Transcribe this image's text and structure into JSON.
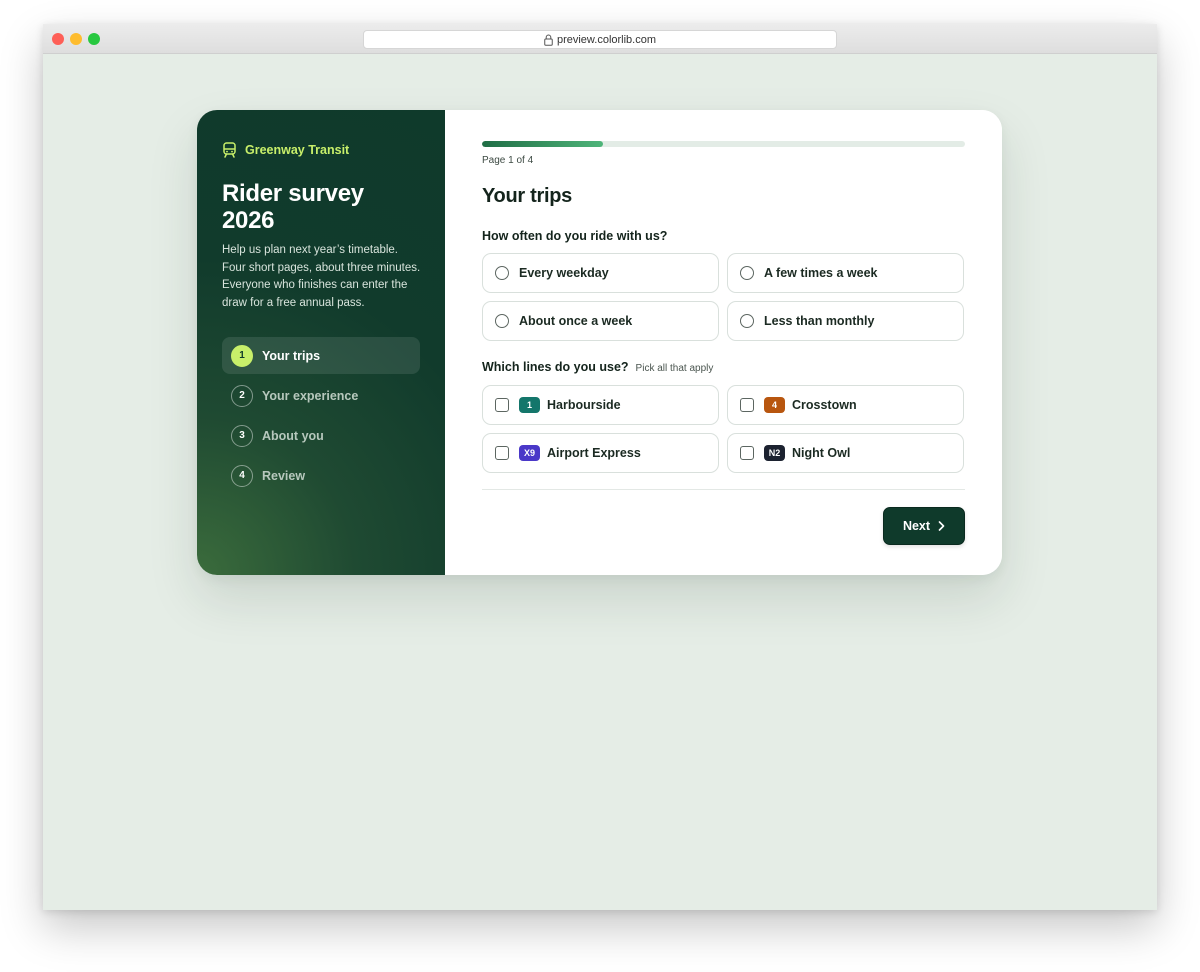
{
  "browser": {
    "url": "preview.colorlib.com"
  },
  "brand": {
    "name": "Greenway Transit",
    "icon": "bus-icon"
  },
  "sidebar": {
    "title": "Rider survey 2026",
    "description": "Help us plan next year’s timetable. Four short pages, about three minutes. Everyone who finishes can enter the draw for a free annual pass.",
    "steps": [
      {
        "num": "1",
        "label": "Your trips",
        "active": true
      },
      {
        "num": "2",
        "label": "Your experience",
        "active": false
      },
      {
        "num": "3",
        "label": "About you",
        "active": false
      },
      {
        "num": "4",
        "label": "Review",
        "active": false
      }
    ]
  },
  "progress": {
    "fraction": 0.25,
    "label": "Page 1 of 4"
  },
  "main": {
    "title": "Your trips",
    "frequency": {
      "question": "How often do you ride with us?",
      "options": [
        "Every weekday",
        "A few times a week",
        "About once a week",
        "Less than monthly"
      ]
    },
    "lines": {
      "question": "Which lines do you use?",
      "hint": "Pick all that apply",
      "options": [
        {
          "code": "1",
          "name": "Harbourside",
          "color": "#14766b"
        },
        {
          "code": "4",
          "name": "Crosstown",
          "color": "#b8560f"
        },
        {
          "code": "X9",
          "name": "Airport Express",
          "color": "#4a38c8"
        },
        {
          "code": "N2",
          "name": "Night Owl",
          "color": "#1c2230"
        }
      ]
    },
    "next_label": "Next"
  },
  "colors": {
    "accent": "#c8ef6a",
    "sidebar": "#0f3a2b",
    "page_bg": "#e5ede6"
  }
}
